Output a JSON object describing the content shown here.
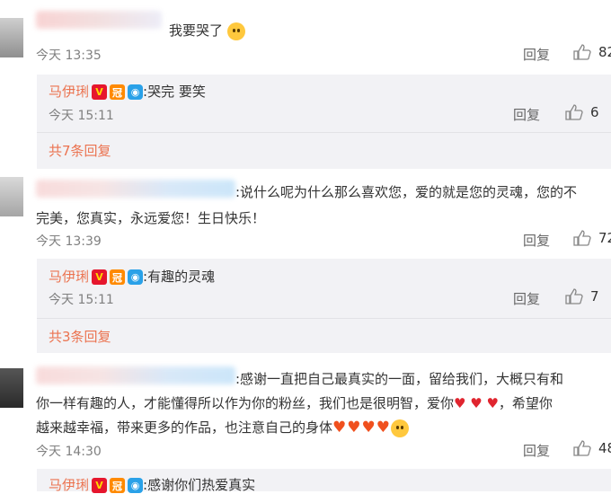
{
  "comments": [
    {
      "text": "我要哭了",
      "time": "今天 13:35",
      "reply_label": "回复",
      "likes": "82",
      "nested": {
        "user": "马伊琍",
        "text": ":哭完 要笑",
        "time": "今天 15:11",
        "reply_label": "回复",
        "likes": "6"
      },
      "more": "共7条回复"
    },
    {
      "text_line1": ":说什么呢为什么那么喜欢您，爱的就是您的灵魂，您的不",
      "text_line2": "完美，您真实，永远爱您！生日快乐！",
      "time": "今天 13:39",
      "reply_label": "回复",
      "likes": "72",
      "nested": {
        "user": "马伊琍",
        "text": ":有趣的灵魂",
        "time": "今天 15:11",
        "reply_label": "回复",
        "likes": "7"
      },
      "more": "共3条回复"
    },
    {
      "text_line1": ":感谢一直把自己最真实的一面，留给我们，大概只有和",
      "text_line2": "你一样有趣的人，才能懂得所以作为你的粉丝，我们也是很明智，爱你",
      "text_line2b": "，希望你",
      "text_line3": "越来越幸福，带来更多的作品，也注意自己的身体",
      "time": "今天 14:30",
      "reply_label": "回复",
      "likes": "48",
      "nested": {
        "user": "马伊琍",
        "text": ":感谢你们热爱真实"
      }
    }
  ],
  "badges": {
    "verified": "V",
    "crown": "冠",
    "camera": "◉"
  },
  "icons": {
    "thumb": "thumb-up-icon",
    "emoji": "sad-face-icon",
    "heart": "heart-icon"
  },
  "colors": {
    "username": "#eb7350",
    "reply_bg": "#f2f2f5",
    "heart": "#e0252f"
  }
}
